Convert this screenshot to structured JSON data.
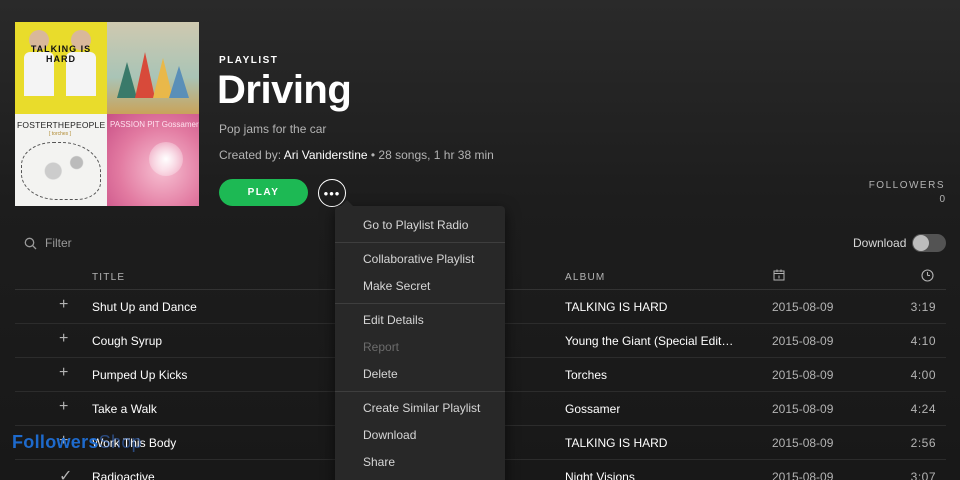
{
  "cover": {
    "tile1_text": "TALKING IS HARD",
    "tile3_text": "FOSTERTHEPEOPLE",
    "tile3_sub": "[ torches ]",
    "tile4_text": "PASSION PIT  Gossamer"
  },
  "playlist": {
    "type_label": "PLAYLIST",
    "title": "Driving",
    "description": "Pop jams for the car",
    "created_prefix": "Created by:",
    "owner": "Ari Vaniderstine",
    "meta_suffix": "• 28 songs, 1 hr 38 min"
  },
  "actions": {
    "play_label": "PLAY",
    "more_label": "•••"
  },
  "followers": {
    "label": "FOLLOWERS",
    "count": "0"
  },
  "filter": {
    "placeholder": "Filter"
  },
  "download": {
    "label": "Download",
    "enabled": false
  },
  "table": {
    "headers": {
      "title": "TITLE",
      "album": "ALBUM"
    },
    "rows": [
      {
        "icon": "+",
        "title": "Shut Up and Dance",
        "album": "TALKING IS HARD",
        "date": "2015-08-09",
        "duration": "3:19"
      },
      {
        "icon": "+",
        "title": "Cough Syrup",
        "album": "Young the Giant (Special Edit…",
        "date": "2015-08-09",
        "duration": "4:10"
      },
      {
        "icon": "+",
        "title": "Pumped Up Kicks",
        "album": "Torches",
        "date": "2015-08-09",
        "duration": "4:00"
      },
      {
        "icon": "+",
        "title": "Take a Walk",
        "album": "Gossamer",
        "date": "2015-08-09",
        "duration": "4:24"
      },
      {
        "icon": "+",
        "title": "Work This Body",
        "album": "TALKING IS HARD",
        "date": "2015-08-09",
        "duration": "2:56"
      },
      {
        "icon": "✓",
        "title": "Radioactive",
        "album": "Night Visions",
        "date": "2015-08-09",
        "duration": "3:07"
      }
    ]
  },
  "context_menu": {
    "groups": [
      [
        "Go to Playlist Radio"
      ],
      [
        "Collaborative Playlist",
        "Make Secret"
      ],
      [
        "Edit Details",
        "Report",
        "Delete"
      ],
      [
        "Create Similar Playlist",
        "Download",
        "Share"
      ]
    ],
    "disabled": [
      "Report"
    ]
  },
  "watermark": {
    "text_a": "Followers",
    "text_b": "Shop"
  },
  "colors": {
    "accent": "#1db954",
    "background": "#181818",
    "menu": "#282828"
  }
}
